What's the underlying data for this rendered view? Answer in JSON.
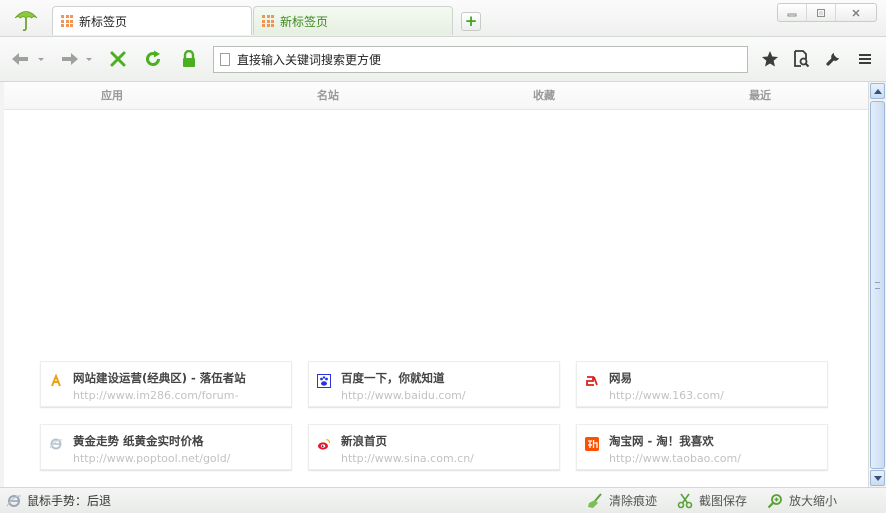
{
  "tabs": [
    {
      "label": "新标签页",
      "active": true
    },
    {
      "label": "新标签页",
      "active": false
    }
  ],
  "new_tab_symbol": "+",
  "window_controls": {
    "minimize": "▭",
    "maximize": "□",
    "close": "✕"
  },
  "toolbar": {
    "icons": [
      "back-arrow-icon",
      "forward-arrow-icon",
      "stop-x-icon",
      "refresh-icon",
      "lock-icon",
      "star-icon",
      "page-search-icon",
      "wrench-icon",
      "menu-icon"
    ]
  },
  "address_bar": {
    "value": "直接输入关键词搜索更方便"
  },
  "nav": [
    "应用",
    "名站",
    "收藏",
    "最近"
  ],
  "speed_dial": [
    {
      "title": "网站建设运营(经典区) - 落伍者站",
      "url": "http://www.im286.com/forum-",
      "favicon": "im286",
      "color": "#e8a41a"
    },
    {
      "title": "百度一下，你就知道",
      "url": "http://www.baidu.com/",
      "favicon": "baidu",
      "color": "#2932e1"
    },
    {
      "title": "网易",
      "url": "http://www.163.com/",
      "favicon": "163",
      "color": "#d9251d"
    },
    {
      "title": "黄金走势 纸黄金实时价格",
      "url": "http://www.poptool.net/gold/",
      "favicon": "ie",
      "color": "#9aa6b5"
    },
    {
      "title": "新浪首页",
      "url": "http://www.sina.com.cn/",
      "favicon": "sina",
      "color": "#e6162d"
    },
    {
      "title": "淘宝网 - 淘！我喜欢",
      "url": "http://www.taobao.com/",
      "favicon": "taobao",
      "color": "#ff5000"
    }
  ],
  "status": {
    "gesture_text": "鼠标手势：后退",
    "clear_label": "清除痕迹",
    "screenshot_label": "截图保存",
    "zoom_label": "放大缩小"
  }
}
